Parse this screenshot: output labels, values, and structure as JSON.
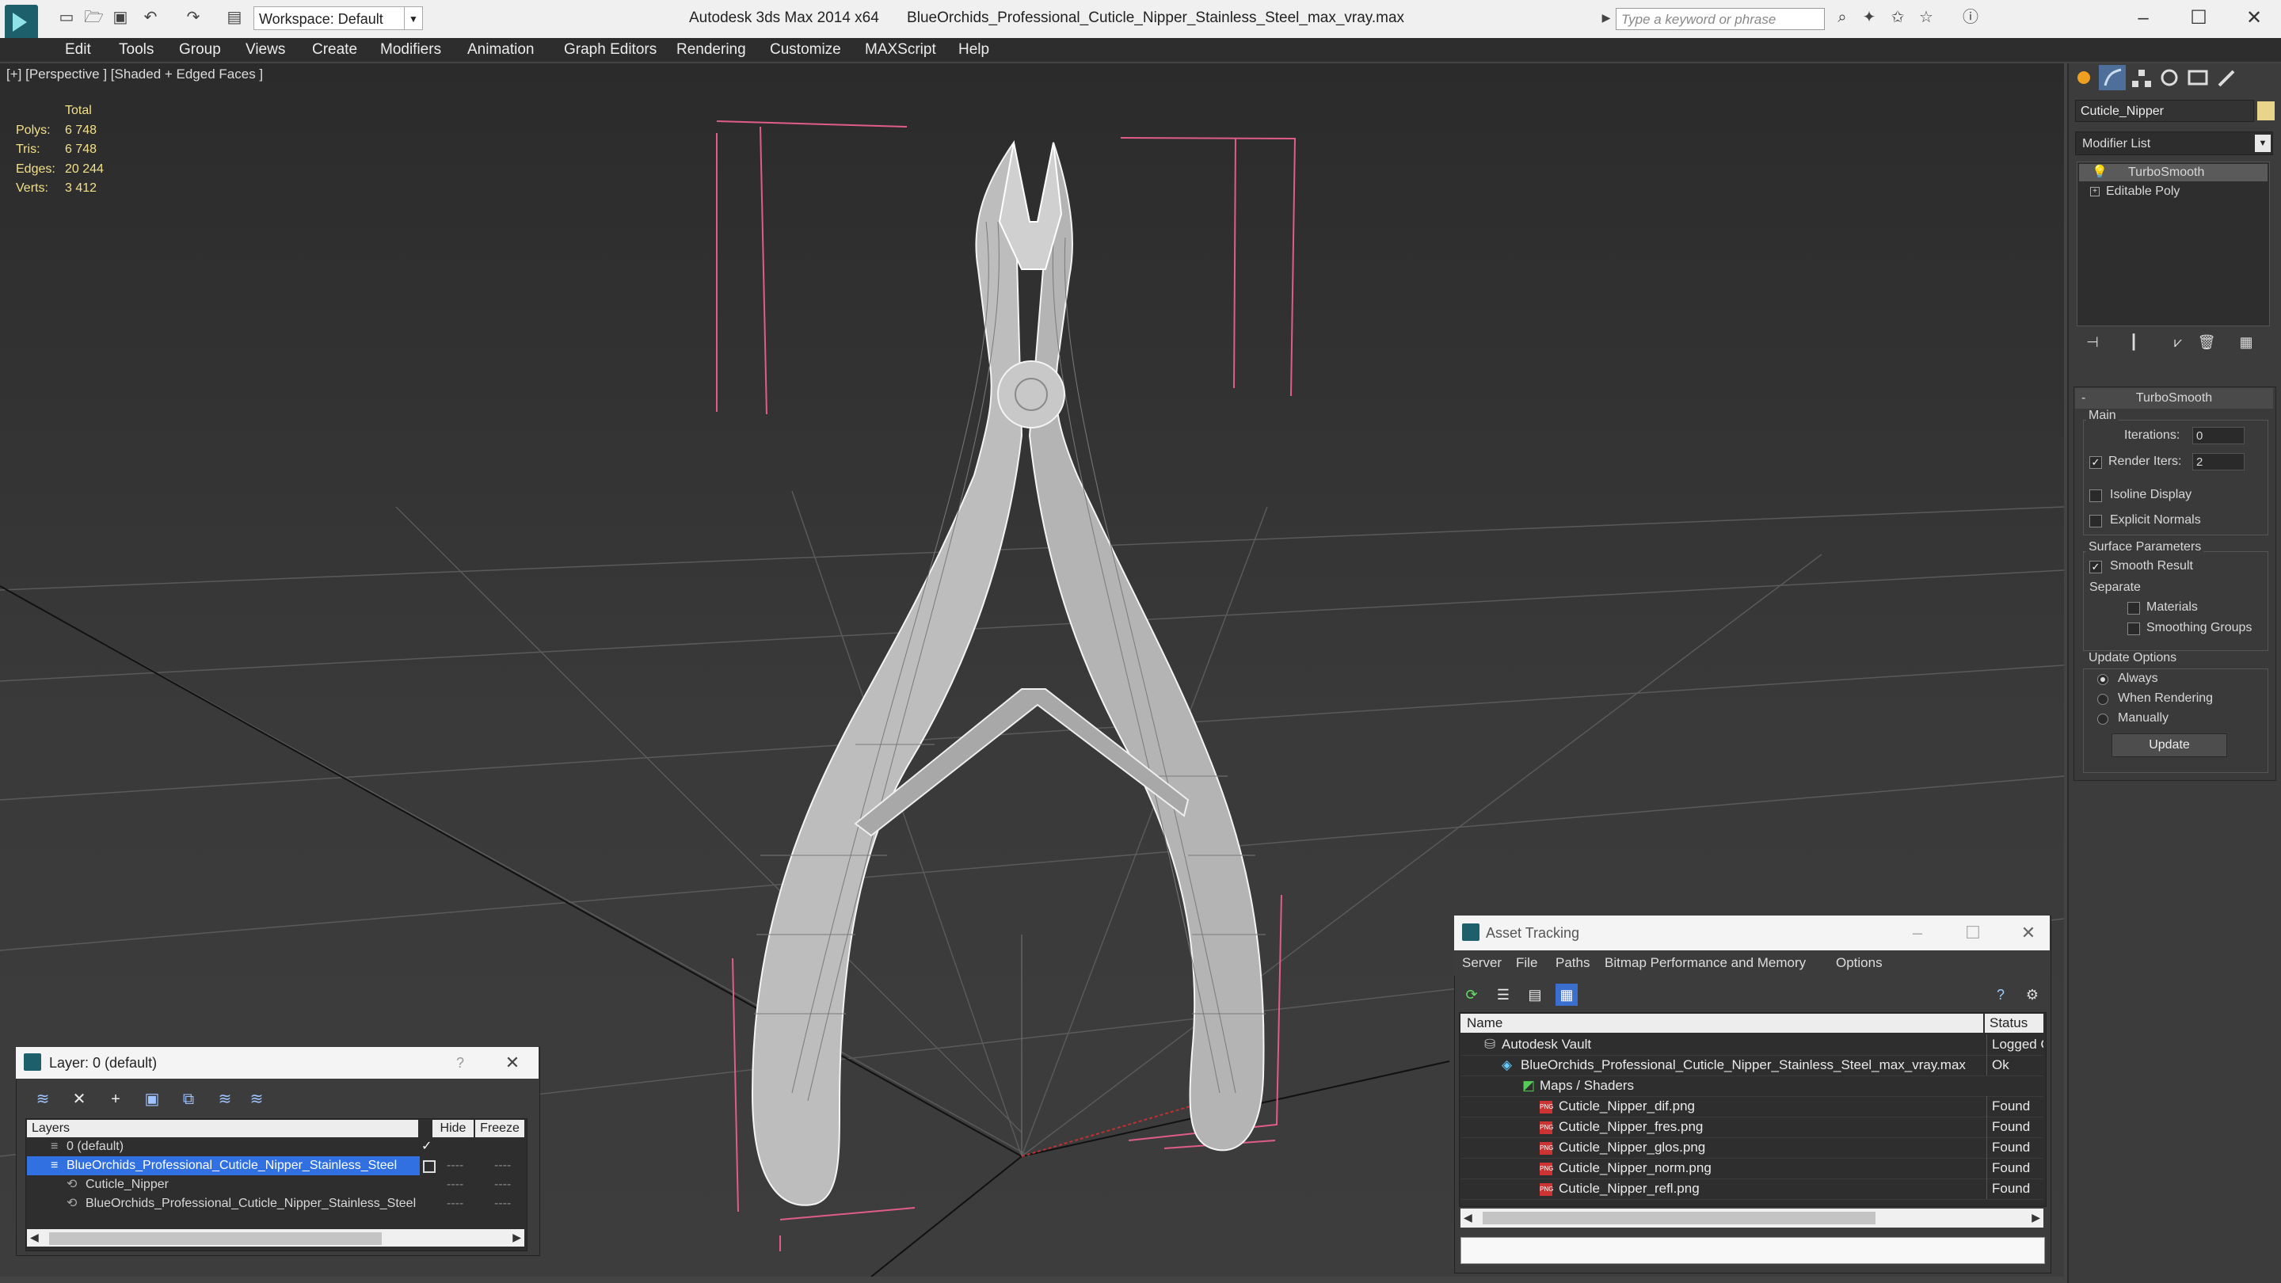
{
  "titlebar": {
    "app": "Autodesk 3ds Max  2014 x64",
    "file": "BlueOrchids_Professional_Cuticle_Nipper_Stainless_Steel_max_vray.max",
    "workspace": "Workspace: Default",
    "search_placeholder": "Type a keyword or phrase"
  },
  "menu": [
    "Edit",
    "Tools",
    "Group",
    "Views",
    "Create",
    "Modifiers",
    "Animation",
    "Graph Editors",
    "Rendering",
    "Customize",
    "MAXScript",
    "Help"
  ],
  "viewport": {
    "label": "[+] [Perspective ] [Shaded + Edged Faces ]",
    "stats": {
      "header": "Total",
      "rows": [
        {
          "k": "Polys:",
          "v": "6 748"
        },
        {
          "k": "Tris:",
          "v": "6 748"
        },
        {
          "k": "Edges:",
          "v": "20 244"
        },
        {
          "k": "Verts:",
          "v": "3 412"
        }
      ]
    }
  },
  "command_panel": {
    "object_name": "Cuticle_Nipper",
    "modifier_list": "Modifier List",
    "stack": [
      "TurboSmooth",
      "Editable Poly"
    ],
    "turbosmooth": {
      "title": "TurboSmooth",
      "main": "Main",
      "iterations_label": "Iterations:",
      "iterations": "0",
      "render_iters_label": "Render Iters:",
      "render_iters": "2",
      "isoline": "Isoline Display",
      "explicit_normals": "Explicit Normals",
      "surface": "Surface Parameters",
      "smooth_result": "Smooth Result",
      "separate": "Separate",
      "materials": "Materials",
      "smoothing_groups": "Smoothing Groups",
      "update_options": "Update Options",
      "always": "Always",
      "when_rendering": "When Rendering",
      "manually": "Manually",
      "update_btn": "Update"
    }
  },
  "layer_dialog": {
    "title": "Layer: 0 (default)",
    "help": "?",
    "columns": {
      "layers": "Layers",
      "hide": "Hide",
      "freeze": "Freeze"
    },
    "rows": [
      {
        "name": "0 (default)",
        "indent": 0
      },
      {
        "name": "BlueOrchids_Professional_Cuticle_Nipper_Stainless_Steel",
        "indent": 0
      },
      {
        "name": "Cuticle_Nipper",
        "indent": 1
      },
      {
        "name": "BlueOrchids_Professional_Cuticle_Nipper_Stainless_Steel",
        "indent": 1
      }
    ],
    "dash": "----"
  },
  "asset_tracking": {
    "title": "Asset Tracking",
    "menu": [
      "Server",
      "File",
      "Paths",
      "Bitmap Performance and Memory",
      "Options"
    ],
    "columns": {
      "name": "Name",
      "status": "Status"
    },
    "rows": [
      {
        "name": "Autodesk Vault",
        "status": "Logged Out",
        "level": 0,
        "icon": "vault"
      },
      {
        "name": "BlueOrchids_Professional_Cuticle_Nipper_Stainless_Steel_max_vray.max",
        "status": "Ok",
        "level": 1,
        "icon": "max"
      },
      {
        "name": "Maps / Shaders",
        "status": "",
        "level": 2,
        "icon": "folder"
      },
      {
        "name": "Cuticle_Nipper_dif.png",
        "status": "Found",
        "level": 3,
        "icon": "png"
      },
      {
        "name": "Cuticle_Nipper_fres.png",
        "status": "Found",
        "level": 3,
        "icon": "png"
      },
      {
        "name": "Cuticle_Nipper_glos.png",
        "status": "Found",
        "level": 3,
        "icon": "png"
      },
      {
        "name": "Cuticle_Nipper_norm.png",
        "status": "Found",
        "level": 3,
        "icon": "png"
      },
      {
        "name": "Cuticle_Nipper_refl.png",
        "status": "Found",
        "level": 3,
        "icon": "png"
      }
    ]
  },
  "colors": {
    "selection": "#3070e0",
    "stats": "#f2e08a",
    "object_color": "#e8d48a",
    "gizmo": "#e05c8a"
  }
}
